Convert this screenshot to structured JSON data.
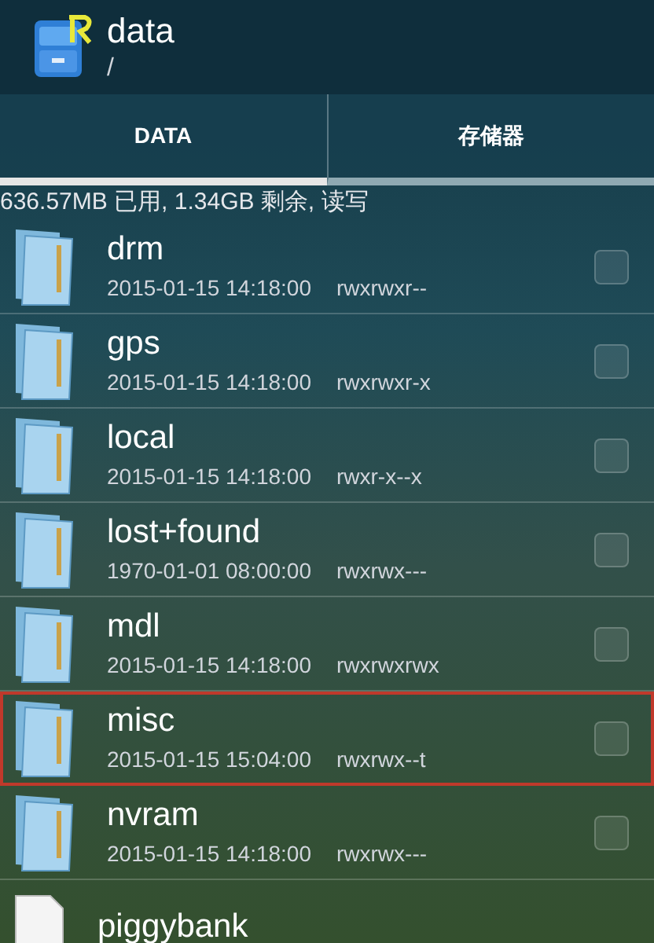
{
  "header": {
    "title": "data",
    "path": "/"
  },
  "tabs": [
    {
      "label": "DATA",
      "selected": true
    },
    {
      "label": "存储器",
      "selected": false
    }
  ],
  "storage_info": "636.57MB 已用, 1.34GB 剩余, 读写",
  "files": [
    {
      "kind": "folder",
      "name": "drm",
      "date": "2015-01-15 14:18:00",
      "permissions": "rwxrwxr--",
      "checked": false,
      "highlighted": false
    },
    {
      "kind": "folder",
      "name": "gps",
      "date": "2015-01-15 14:18:00",
      "permissions": "rwxrwxr-x",
      "checked": false,
      "highlighted": false
    },
    {
      "kind": "folder",
      "name": "local",
      "date": "2015-01-15 14:18:00",
      "permissions": "rwxr-x--x",
      "checked": false,
      "highlighted": false
    },
    {
      "kind": "folder",
      "name": "lost+found",
      "date": "1970-01-01 08:00:00",
      "permissions": "rwxrwx---",
      "checked": false,
      "highlighted": false
    },
    {
      "kind": "folder",
      "name": "mdl",
      "date": "2015-01-15 14:18:00",
      "permissions": "rwxrwxrwx",
      "checked": false,
      "highlighted": false
    },
    {
      "kind": "folder",
      "name": "misc",
      "date": "2015-01-15 15:04:00",
      "permissions": "rwxrwx--t",
      "checked": false,
      "highlighted": true
    },
    {
      "kind": "folder",
      "name": "nvram",
      "date": "2015-01-15 14:18:00",
      "permissions": "rwxrwx---",
      "checked": false,
      "highlighted": false
    },
    {
      "kind": "file",
      "name": "piggybank",
      "highlighted": false
    }
  ]
}
